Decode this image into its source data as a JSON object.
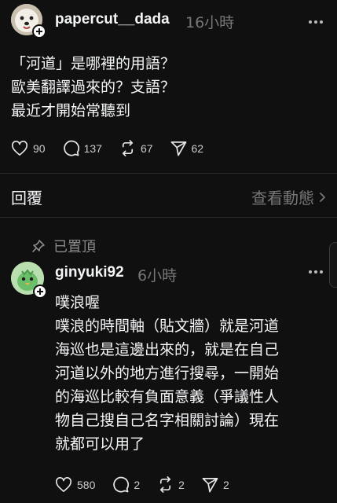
{
  "post": {
    "username": "papercut__dada",
    "time": "16小時",
    "text": "「河道」是哪裡的用語？\n歐美翻譯過來的？支語？\n最近才開始常聽到",
    "likes": "90",
    "comments": "137",
    "reposts": "67",
    "shares": "62"
  },
  "replies_bar": {
    "label": "回覆",
    "view_activity": "查看動態"
  },
  "pinned_label": "已置頂",
  "reply": {
    "username": "ginyuki92",
    "time": "6小時",
    "text": "噗浪喔\n噗浪的時間軸（貼文牆）就是河道\n海巡也是這邊出來的，就是在自己\n河道以外的地方進行搜尋，一開始\n的海巡比較有負面意義（爭議性人\n物自己搜自己名字相關討論）現在\n就都可以用了",
    "likes": "580",
    "comments": "2",
    "reposts": "2",
    "shares": "2"
  },
  "colors": {
    "background": "#101010",
    "text": "#f3f5f7",
    "muted": "#777777"
  }
}
